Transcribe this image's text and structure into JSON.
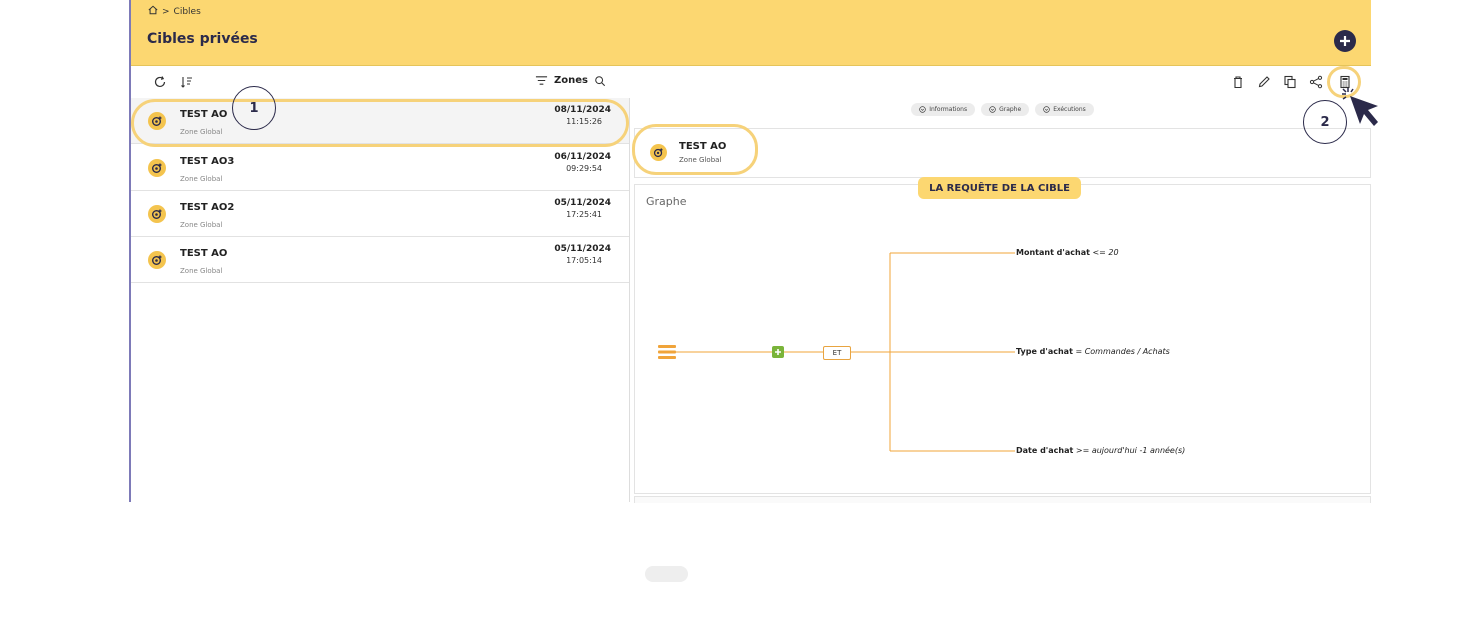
{
  "breadcrumb": {
    "label": "Cibles"
  },
  "header": {
    "title": "Cibles privées"
  },
  "toolbar": {
    "filter_label": "Zones"
  },
  "list": [
    {
      "name": "TEST AO",
      "zone": "Zone Global",
      "date": "08/11/2024",
      "time": "11:15:26"
    },
    {
      "name": "TEST AO3",
      "zone": "Zone Global",
      "date": "06/11/2024",
      "time": "09:29:54"
    },
    {
      "name": "TEST AO2",
      "zone": "Zone Global",
      "date": "05/11/2024",
      "time": "17:25:41"
    },
    {
      "name": "TEST AO",
      "zone": "Zone Global",
      "date": "05/11/2024",
      "time": "17:05:14"
    }
  ],
  "tabs": [
    {
      "label": "Informations"
    },
    {
      "label": "Graphe"
    },
    {
      "label": "Exécutions"
    }
  ],
  "detail": {
    "title": "TEST AO",
    "zone": "Zone Global"
  },
  "annotation": {
    "label": "LA REQUÊTE DE LA CIBLE",
    "step1": "1",
    "step2": "2"
  },
  "graph": {
    "title": "Graphe",
    "operator": "ET",
    "conditions": [
      {
        "field": "Montant d'achat",
        "op": "<=",
        "value": "20"
      },
      {
        "field": "Type d'achat",
        "op": "=",
        "value": "Commandes / Achats"
      },
      {
        "field": "Date d'achat",
        "op": ">=",
        "value": "aujourd'hui -1 année(s)"
      }
    ]
  },
  "colors": {
    "header": "#fcd771",
    "accent": "#2b2a4a",
    "line": "#f0a43a",
    "highlight": "#f6d27a"
  }
}
